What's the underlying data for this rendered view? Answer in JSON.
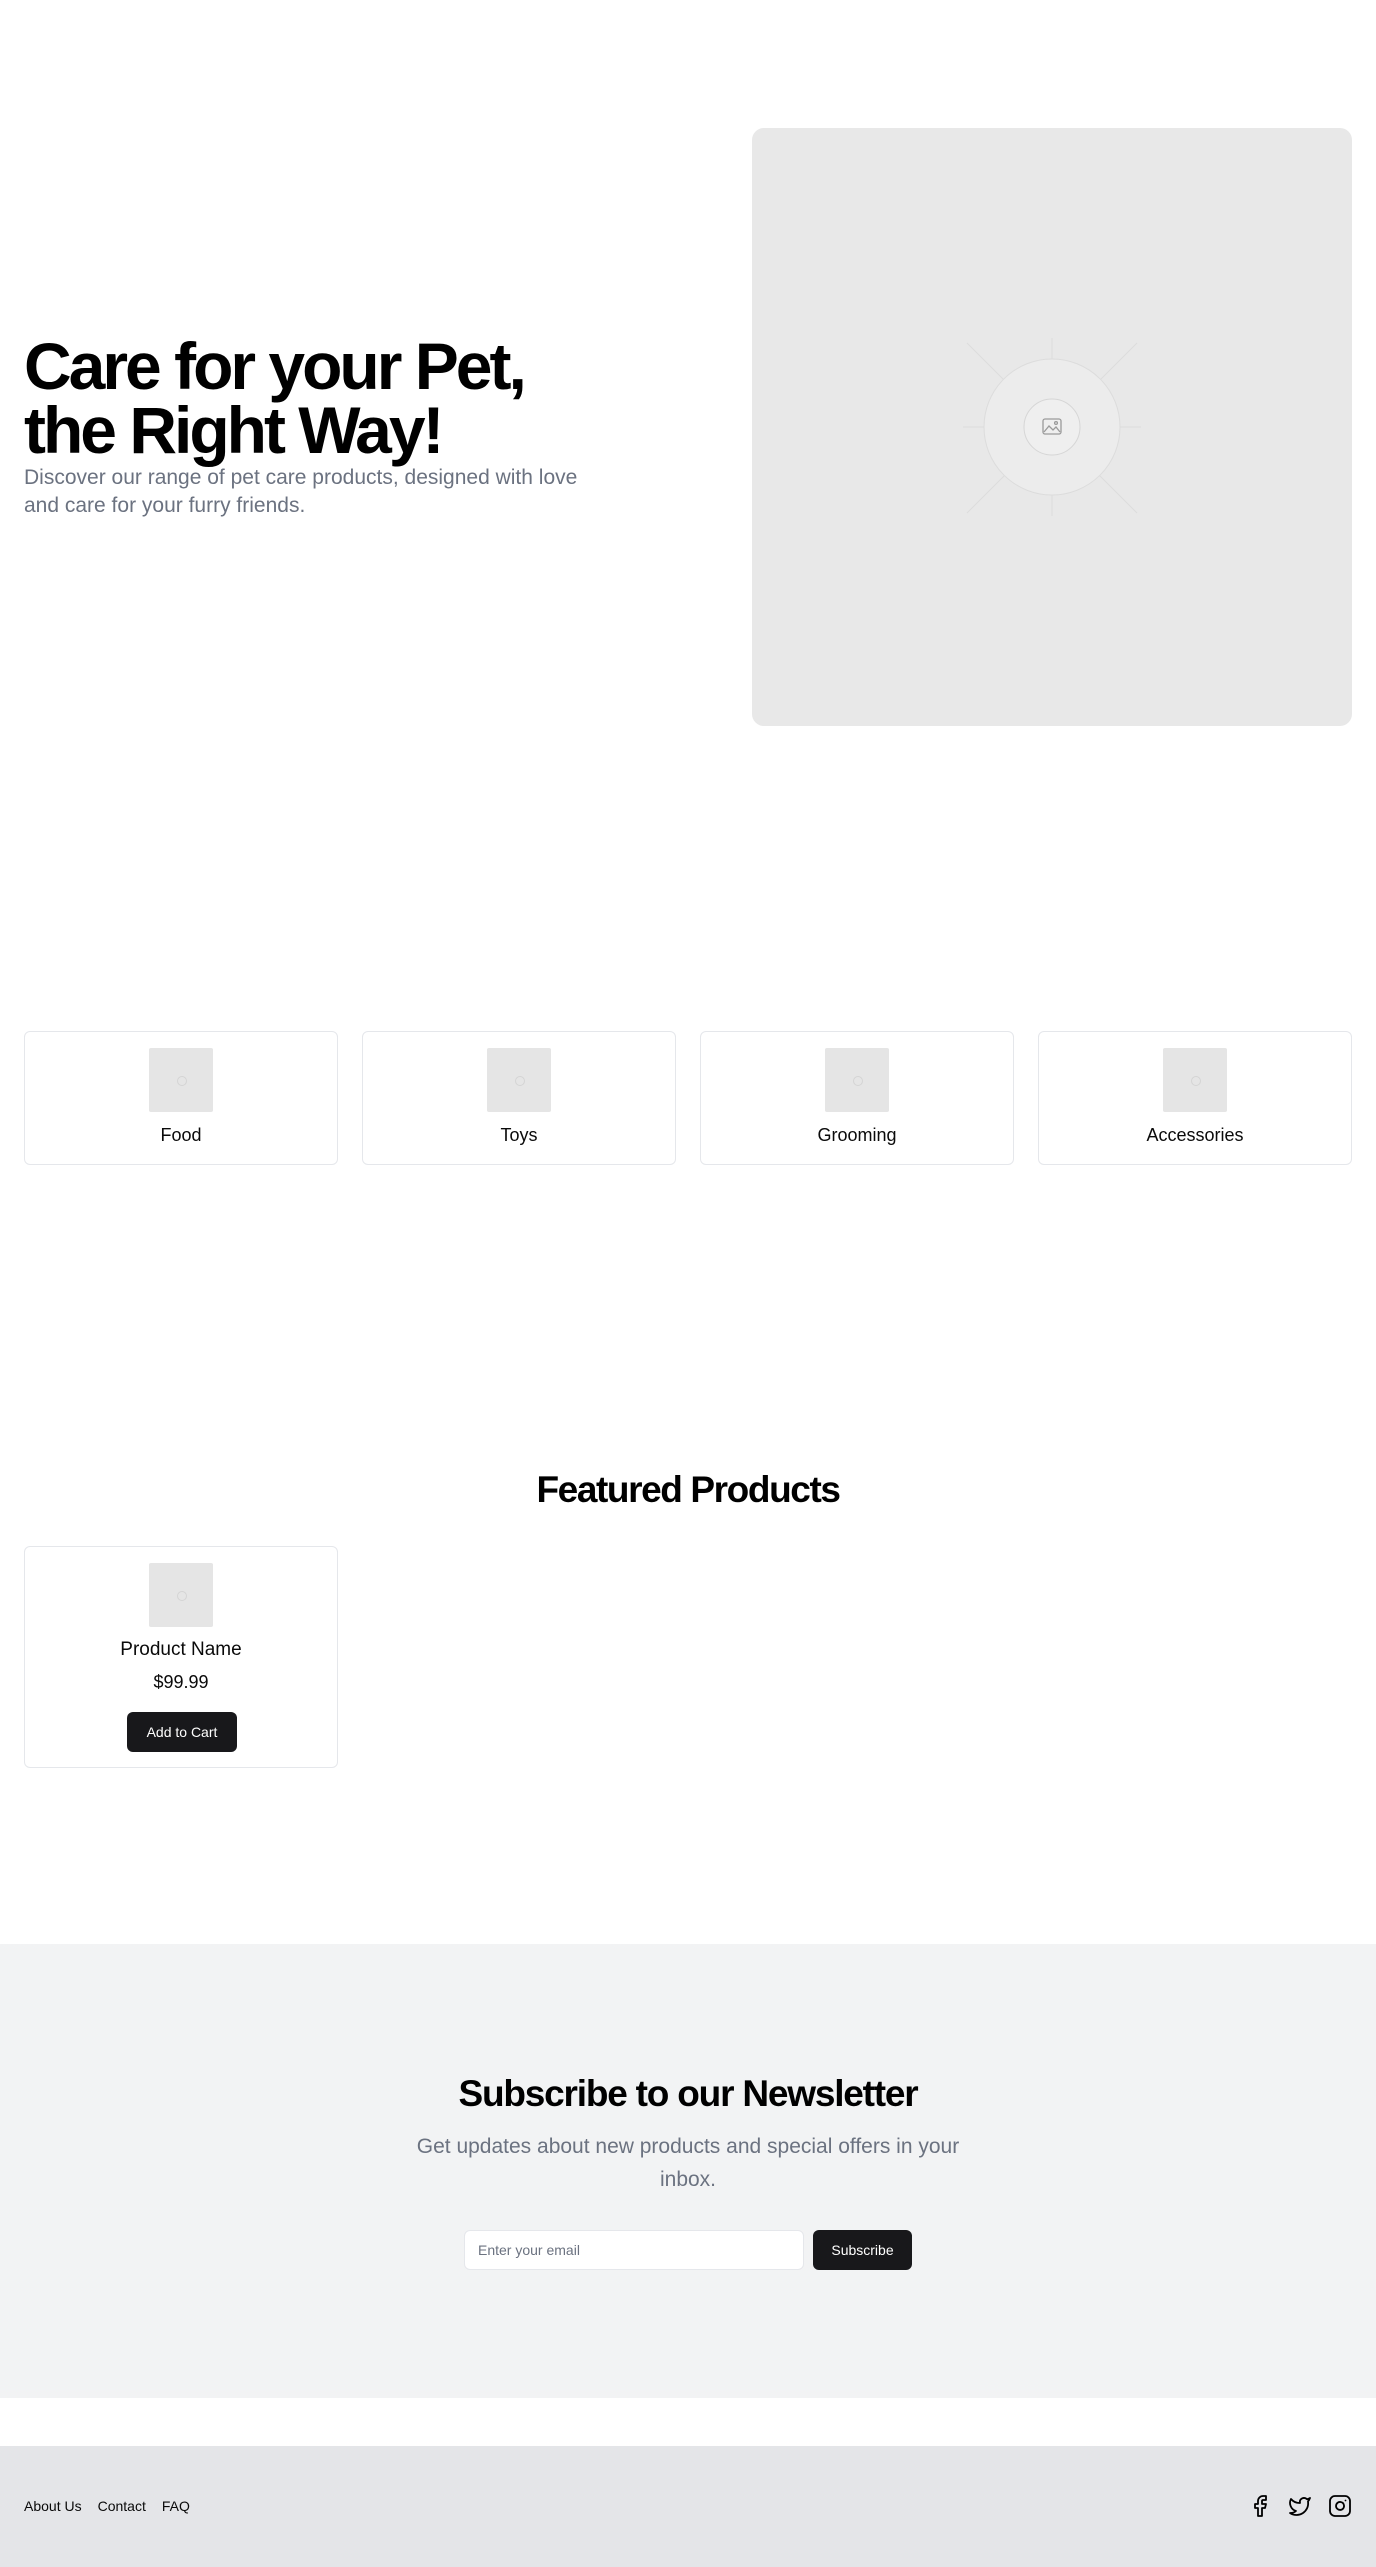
{
  "hero": {
    "title": "Care for your Pet, the Right Way!",
    "subtitle": "Discover our range of pet care products, designed with love and care for your furry friends.",
    "image_icon": "image-placeholder-icon"
  },
  "categories": [
    {
      "label": "Food",
      "icon": "image-placeholder-icon"
    },
    {
      "label": "Toys",
      "icon": "image-placeholder-icon"
    },
    {
      "label": "Grooming",
      "icon": "image-placeholder-icon"
    },
    {
      "label": "Accessories",
      "icon": "image-placeholder-icon"
    }
  ],
  "featured": {
    "title": "Featured Products",
    "products": [
      {
        "name": "Product Name",
        "price": "$99.99",
        "button_label": "Add to Cart"
      }
    ]
  },
  "newsletter": {
    "title": "Subscribe to our Newsletter",
    "subtitle": "Get updates about new products and special offers in your inbox.",
    "email_placeholder": "Enter your email",
    "email_value": "",
    "button_label": "Subscribe"
  },
  "footer": {
    "links": [
      "About Us",
      "Contact",
      "FAQ"
    ],
    "social_icons": [
      "facebook-icon",
      "twitter-icon",
      "instagram-icon"
    ]
  },
  "colors": {
    "primary_button": "#18181b",
    "muted_text": "#6b7280",
    "newsletter_bg": "#f2f3f4",
    "footer_bg": "#e4e5e8",
    "placeholder_bg": "#e8e8e8"
  }
}
